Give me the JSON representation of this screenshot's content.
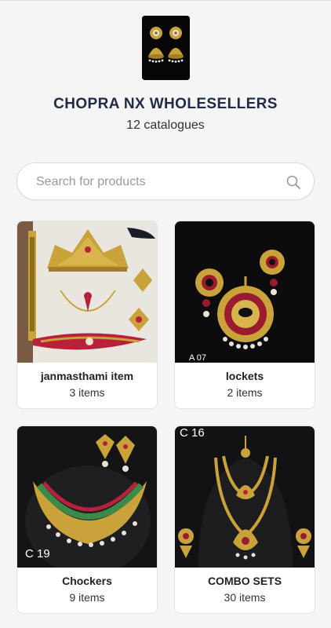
{
  "store": {
    "name": "CHOPRA NX WHOLESELLERS",
    "subtitle": "12 catalogues"
  },
  "search": {
    "placeholder": "Search for products"
  },
  "catalogues": [
    {
      "title": "janmasthami item",
      "count": "3 items",
      "code": ""
    },
    {
      "title": "lockets",
      "count": "2 items",
      "code": "A 07"
    },
    {
      "title": "Chockers",
      "count": "9 items",
      "code": "C 19"
    },
    {
      "title": "COMBO SETS",
      "count": "30 items",
      "code": "C 16"
    }
  ],
  "icons": {
    "search": "search-icon",
    "logo": "earrings-logo"
  },
  "colors": {
    "background": "#f5f5f5",
    "title": "#1f2a44",
    "card": "#ffffff",
    "gold": "#c9a23a"
  }
}
